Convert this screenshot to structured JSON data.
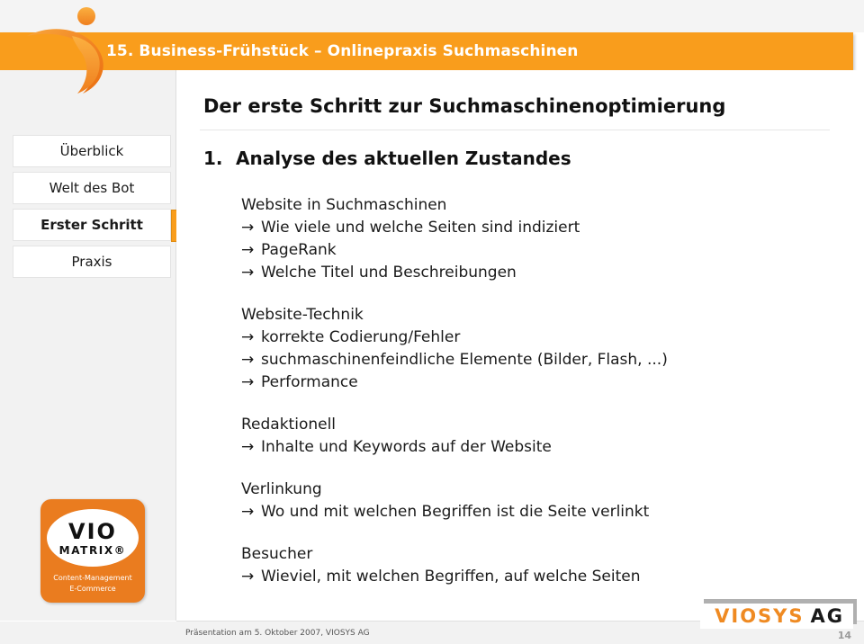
{
  "header": {
    "title": "15. Business-Frühstück – Onlinepraxis Suchmaschinen",
    "bar_color": "#f99d1c",
    "logo_icon": "viosys-swoosh-logo"
  },
  "sidebar": {
    "items": [
      {
        "label": "Überblick",
        "active": false
      },
      {
        "label": "Welt des Bot",
        "active": false
      },
      {
        "label": "Erster Schritt",
        "active": true
      },
      {
        "label": "Praxis",
        "active": false
      }
    ],
    "logo": {
      "name": "vio-matrix-logo",
      "word_top": "VIO",
      "word_bottom": "MATRIX®",
      "tagline_line1": "Content-Management",
      "tagline_line2": "E-Commerce",
      "color": "#ea7c1f"
    }
  },
  "main": {
    "slide_title": "Der erste Schritt zur Suchmaschinenoptimierung",
    "section_number": "1.",
    "section_title": "Analyse des aktuellen Zustandes",
    "arrow_glyph": "→",
    "blocks": [
      {
        "title": "Website in Suchmaschinen",
        "items": [
          "Wie viele und welche Seiten sind indiziert",
          "PageRank",
          "Welche Titel und Beschreibungen"
        ]
      },
      {
        "title": "Website-Technik",
        "items": [
          "korrekte Codierung/Fehler",
          "suchmaschinenfeindliche Elemente (Bilder, Flash, ...)",
          "Performance"
        ]
      },
      {
        "title": "Redaktionell",
        "items": [
          "Inhalte und Keywords auf der Website"
        ]
      },
      {
        "title": "Verlinkung",
        "items": [
          "Wo und mit welchen Begriffen ist die Seite verlinkt"
        ]
      },
      {
        "title": "Besucher",
        "items": [
          "Wieviel, mit welchen Begriffen, auf welche Seiten"
        ]
      }
    ]
  },
  "footer": {
    "text": "Präsentation am 5. Oktober 2007, VIOSYS AG",
    "page_number": "14",
    "company_logo": {
      "name": "viosys-ag-logo",
      "word_orange": "VIOSYS",
      "word_black": "AG"
    }
  }
}
